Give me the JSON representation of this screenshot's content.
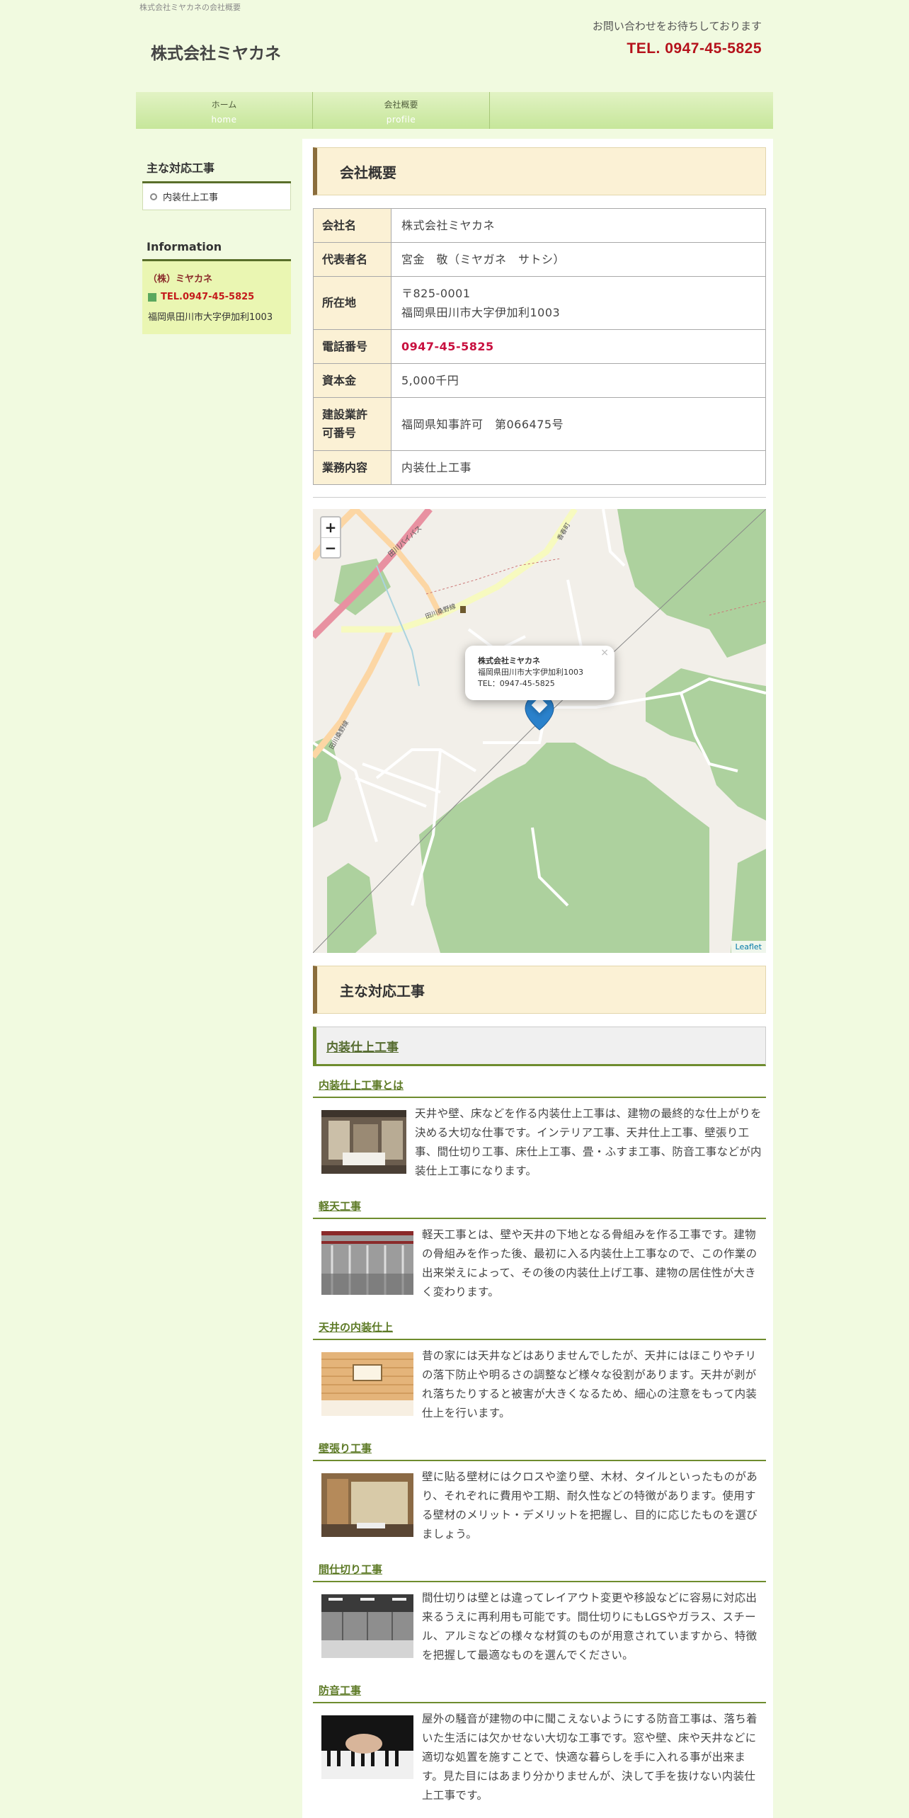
{
  "header": {
    "tagline": "株式会社ミヤカネの会社概要",
    "site_title": "株式会社ミヤカネ",
    "contact_note": "お問い合わせをお待ちしております",
    "tel": "TEL. 0947-45-5825"
  },
  "nav": [
    {
      "jp": "ホーム",
      "en": "home"
    },
    {
      "jp": "会社概要",
      "en": "profile"
    }
  ],
  "sidebar": {
    "services_title": "主な対応工事",
    "services": [
      "内装仕上工事"
    ],
    "info_title": "Information",
    "info_name": "（株）ミヤカネ",
    "info_tel": "TEL.0947-45-5825",
    "info_addr": "福岡県田川市大字伊加利1003"
  },
  "main": {
    "profile_heading": "会社概要",
    "profile_rows": [
      {
        "label": "会社名",
        "value": "株式会社ミヤカネ"
      },
      {
        "label": "代表者名",
        "value": "宮金　敬（ミヤガネ　サトシ）"
      },
      {
        "label": "所在地",
        "value_line1": "〒825-0001",
        "value_line2": "福岡県田川市大字伊加利1003"
      },
      {
        "label": "電話番号",
        "value": "0947-45-5825"
      },
      {
        "label": "資本金",
        "value": "5,000千円"
      },
      {
        "label_line1": "建設業許",
        "label_line2": "可番号",
        "value": "福岡県知事許可　第066475号"
      },
      {
        "label": "業務内容",
        "value": "内装仕上工事"
      }
    ],
    "map": {
      "popup_name": "株式会社ミヤカネ",
      "popup_addr": "福岡県田川市大字伊加利1003",
      "popup_tel": "TEL：0947-45-5825",
      "zoom_in": "+",
      "zoom_out": "−",
      "attribution": "Leaflet",
      "road_label_1": "田川バイパス",
      "road_label_2": "田川桑野線",
      "road_label_3": "田川桑野線",
      "road_label_4": "香春町"
    },
    "services_heading": "主な対応工事",
    "sub_heading": "内装仕上工事",
    "sections": [
      {
        "title": "内装仕上工事とは",
        "text": "天井や壁、床などを作る内装仕上工事は、建物の最終的な仕上がりを決める大切な仕事です。インテリア工事、天井仕上工事、壁張り工事、間仕切り工事、床仕上工事、畳・ふすま工事、防音工事などが内装仕上工事になります。"
      },
      {
        "title": "軽天工事",
        "text": "軽天工事とは、壁や天井の下地となる骨組みを作る工事です。建物の骨組みを作った後、最初に入る内装仕上工事なので、この作業の出来栄えによって、その後の内装仕上げ工事、建物の居住性が大きく変わります。"
      },
      {
        "title": "天井の内装仕上",
        "text": "昔の家には天井などはありませんでしたが、天井にはほこりやチリの落下防止や明るさの調整など様々な役割があります。天井が剥がれ落ちたりすると被害が大きくなるため、細心の注意をもって内装仕上を行います。"
      },
      {
        "title": "壁張り工事",
        "text": "壁に貼る壁材にはクロスや塗り壁、木材、タイルといったものがあり、それぞれに費用や工期、耐久性などの特徴があります。使用する壁材のメリット・デメリットを把握し、目的に応じたものを選びましょう。"
      },
      {
        "title": "間仕切り工事",
        "text": "間仕切りは壁とは違ってレイアウト変更や移設などに容易に対応出来るうえに再利用も可能です。間仕切りにもLGSやガラス、スチール、アルミなどの様々な材質のものが用意されていますから、特徴を把握して最適なものを選んでください。"
      },
      {
        "title": "防音工事",
        "text": "屋外の騒音が建物の中に聞こえないようにする防音工事は、落ち着いた生活には欠かせない大切な工事です。窓や壁、床や天井などに適切な処置を施すことで、快適な暮らしを手に入れる事が出来ます。見た目にはあまり分かりませんが、決して手を抜けない内装仕上工事です。"
      }
    ]
  }
}
